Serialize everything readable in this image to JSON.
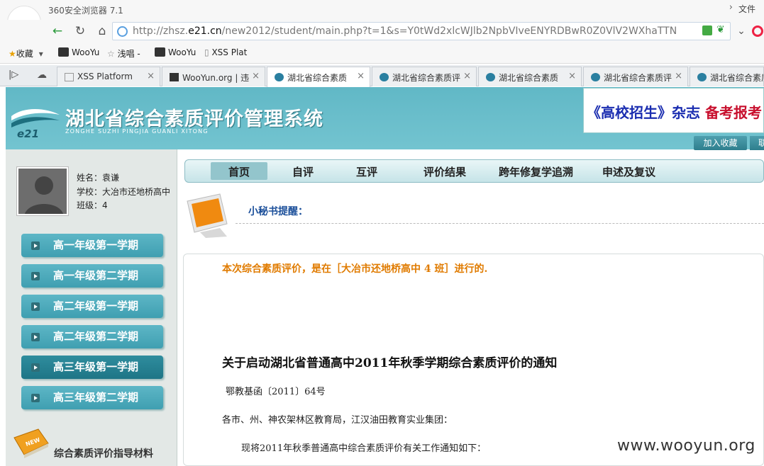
{
  "browser": {
    "title": "360安全浏览器 7.1",
    "file_menu": "文件",
    "url_prefix": "http://zhsz.",
    "url_host": "e21.cn",
    "url_rest": "/new2012/student/main.php?t=1&s=Y0tWd2xlcWJlb2NpbVIveENYRDBwR0Z0VlV2WXhaTTN"
  },
  "bookmarks": [
    {
      "label": "收藏"
    },
    {
      "label": "WooYu"
    },
    {
      "label": "浅唱 -"
    },
    {
      "label": "WooYu"
    },
    {
      "label": "XSS Plat"
    }
  ],
  "tabs": [
    {
      "label": "XSS Platform"
    },
    {
      "label": "WooYun.org | 违"
    },
    {
      "label": "湖北省综合素质"
    },
    {
      "label": "湖北省综合素质评"
    },
    {
      "label": "湖北省综合素质"
    },
    {
      "label": "湖北省综合素质评"
    },
    {
      "label": "湖北省综合素质"
    }
  ],
  "site": {
    "title": "湖北省综合素质评价管理系统",
    "subtitle": "ZONGHE SUZHI PINGJIA GUANLI XITONG",
    "logo_text": "e21",
    "ad_part1": "《高校招生》杂志",
    "ad_part2": " 备考报考",
    "fav_button": "加入收藏",
    "fav_button2": "联"
  },
  "user": {
    "name": "姓名：袁谦",
    "school": "学校：大冶市还地桥高中",
    "class": "班级：4"
  },
  "semesters": [
    {
      "label": "高一年级第一学期"
    },
    {
      "label": "高一年级第二学期"
    },
    {
      "label": "高二年级第一学期"
    },
    {
      "label": "高二年级第二学期"
    },
    {
      "label": "高三年级第一学期"
    },
    {
      "label": "高三年级第二学期"
    }
  ],
  "guide": {
    "label": "综合素质评价指导材料",
    "book_text": "NEW"
  },
  "nav": {
    "home": "首页",
    "self": "自评",
    "peer": "互评",
    "result": "评价结果",
    "cross": "跨年修复学追溯",
    "appeal": "申述及复议"
  },
  "secretary": {
    "label": "小秘书提醒："
  },
  "content": {
    "eval_note": "本次综合素质评价，是在［大冶市还地桥高中 4 班］进行的.",
    "notice_title": "关于启动湖北省普通高中2011年秋季学期综合素质评价的通知",
    "doc_no": "鄂教基函〔2011〕64号",
    "recipients": "各市、州、神农架林区教育局，江汉油田教育实业集团：",
    "para1": "现将2011年秋季普通高中综合素质评价有关工作通知如下："
  },
  "watermark": "www.wooyun.org",
  "colors": {
    "banner": "#6abdca",
    "semester_button": "#4aa8b9",
    "nav_bar": "#d6eef0",
    "eval_note": "#e07b00",
    "secretary": "#1b4f9a"
  }
}
